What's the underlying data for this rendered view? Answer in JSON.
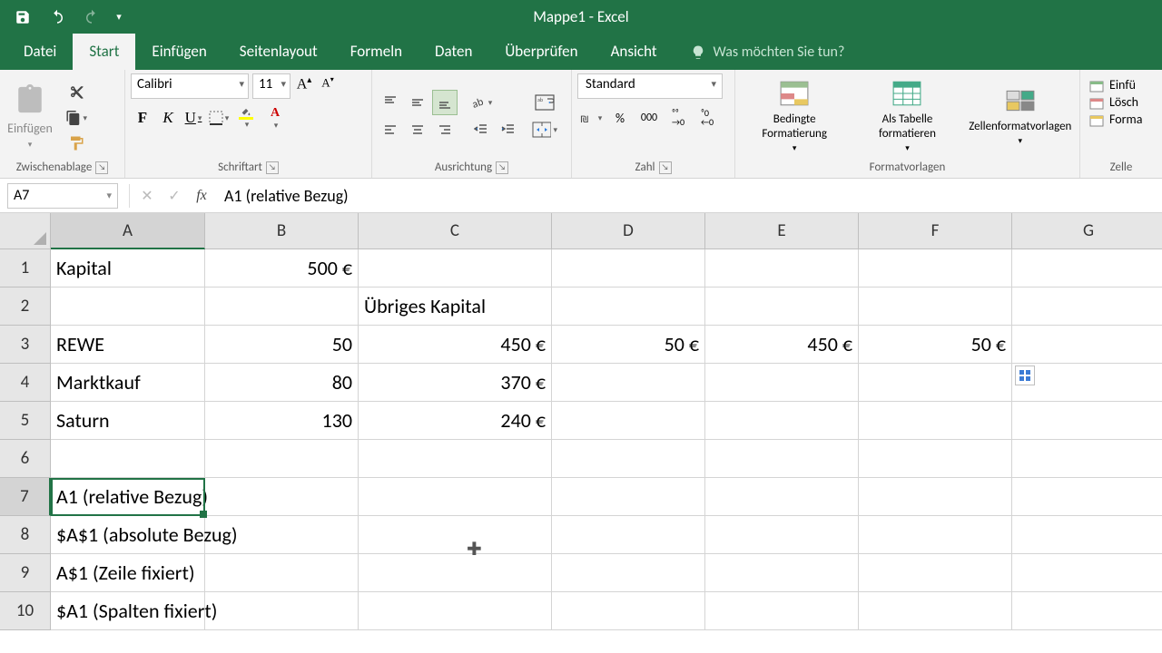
{
  "app": {
    "title": "Mappe1 - Excel"
  },
  "tabs": {
    "file": "Datei",
    "home": "Start",
    "insert": "Einfügen",
    "pagelayout": "Seitenlayout",
    "formulas": "Formeln",
    "data": "Daten",
    "review": "Überprüfen",
    "view": "Ansicht",
    "tellme_placeholder": "Was möchten Sie tun?"
  },
  "ribbon": {
    "clipboard": {
      "paste": "Einfügen",
      "label": "Zwischenablage"
    },
    "font": {
      "name": "Calibri",
      "size": "11",
      "label": "Schriftart"
    },
    "alignment": {
      "label": "Ausrichtung"
    },
    "number": {
      "format": "Standard",
      "label": "Zahl"
    },
    "styles": {
      "cond": "Bedingte Formatierung",
      "table": "Als Tabelle formatieren",
      "cellstyles": "Zellenformatvorlagen",
      "label": "Formatvorlagen"
    },
    "cells": {
      "insert": "Einfü",
      "delete": "Lösch",
      "format": "Forma",
      "label": "Zelle"
    }
  },
  "formula_bar": {
    "namebox": "A7",
    "formula": "A1 (relative Bezug)"
  },
  "columns": [
    "A",
    "B",
    "C",
    "D",
    "E",
    "F",
    "G"
  ],
  "rows_visible": [
    "1",
    "2",
    "3",
    "4",
    "5",
    "6",
    "7",
    "8",
    "9",
    "10"
  ],
  "active_cell": "A7",
  "grid": {
    "r1": {
      "A": "Kapital",
      "B": "500 €"
    },
    "r2": {
      "C": "Übriges Kapital"
    },
    "r3": {
      "A": "REWE",
      "B": "50",
      "C": "450 €",
      "D": "50 €",
      "E": "450 €",
      "F": "50 €"
    },
    "r4": {
      "A": "Marktkauf",
      "B": "80",
      "C": "370 €"
    },
    "r5": {
      "A": "Saturn",
      "B": "130",
      "C": "240 €"
    },
    "r7": {
      "A": "A1 (relative Bezug)"
    },
    "r8": {
      "A": "$A$1 (absolute Bezug)"
    },
    "r9": {
      "A": "A$1 (Zeile fixiert)"
    },
    "r10": {
      "A": "$A1 (Spalten fixiert)"
    }
  }
}
